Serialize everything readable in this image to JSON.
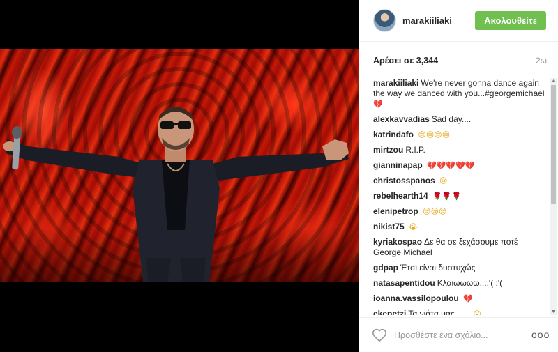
{
  "post": {
    "username": "marakiiliaki",
    "follow_label": "Ακολουθείτε",
    "likes_text": "Αρέσει σε 3,344",
    "time_ago": "2ω"
  },
  "comments": [
    {
      "user": "marakiiliaki",
      "text": "We're never gonna dance again the way we danced with you...#georgemichael",
      "emoji": "💔",
      "emoji_kind": "heart"
    },
    {
      "user": "alexkavvadias",
      "text": "Sad day....",
      "emoji": "",
      "emoji_kind": ""
    },
    {
      "user": "katrindafo",
      "text": "",
      "emoji": "😢😢😢😢",
      "emoji_kind": "face"
    },
    {
      "user": "mirtzou",
      "text": "R.I.P.",
      "emoji": "",
      "emoji_kind": ""
    },
    {
      "user": "gianninapap",
      "text": "",
      "emoji": "💔💔💔💔💔",
      "emoji_kind": "heart"
    },
    {
      "user": "christosspanos",
      "text": "",
      "emoji": "😢",
      "emoji_kind": "face"
    },
    {
      "user": "rebelhearth14",
      "text": "",
      "emoji": "🌹🌹🌹",
      "emoji_kind": "flower"
    },
    {
      "user": "elenipetrop",
      "text": "",
      "emoji": "😢😢😢",
      "emoji_kind": "face"
    },
    {
      "user": "nikist75",
      "text": "",
      "emoji": "😭",
      "emoji_kind": "face"
    },
    {
      "user": "kyriakospao",
      "text": "Δε θα σε ξεχάσουμε ποτέ George Michael",
      "emoji": "",
      "emoji_kind": ""
    },
    {
      "user": "gdpap",
      "text": "Έτσι είναι δυστυχώς",
      "emoji": "",
      "emoji_kind": ""
    },
    {
      "user": "natasapentidou",
      "text": "Κλαιωωωω....'( :'(",
      "emoji": "",
      "emoji_kind": ""
    },
    {
      "user": "ioanna.vassilopoulou",
      "text": "",
      "emoji": "💔",
      "emoji_kind": "heart"
    },
    {
      "user": "ekepetzi",
      "text": "Τα νιάτα μας.......",
      "emoji": "😮",
      "emoji_kind": "face"
    }
  ],
  "footer": {
    "comment_placeholder": "Προσθέστε ένα σχόλιο...",
    "more_label": "ooo"
  },
  "icons": {
    "like": "heart-outline-icon",
    "more": "ellipsis-icon"
  },
  "colors": {
    "follow_button": "#70c050",
    "heart_emoji": "#c0182a"
  }
}
